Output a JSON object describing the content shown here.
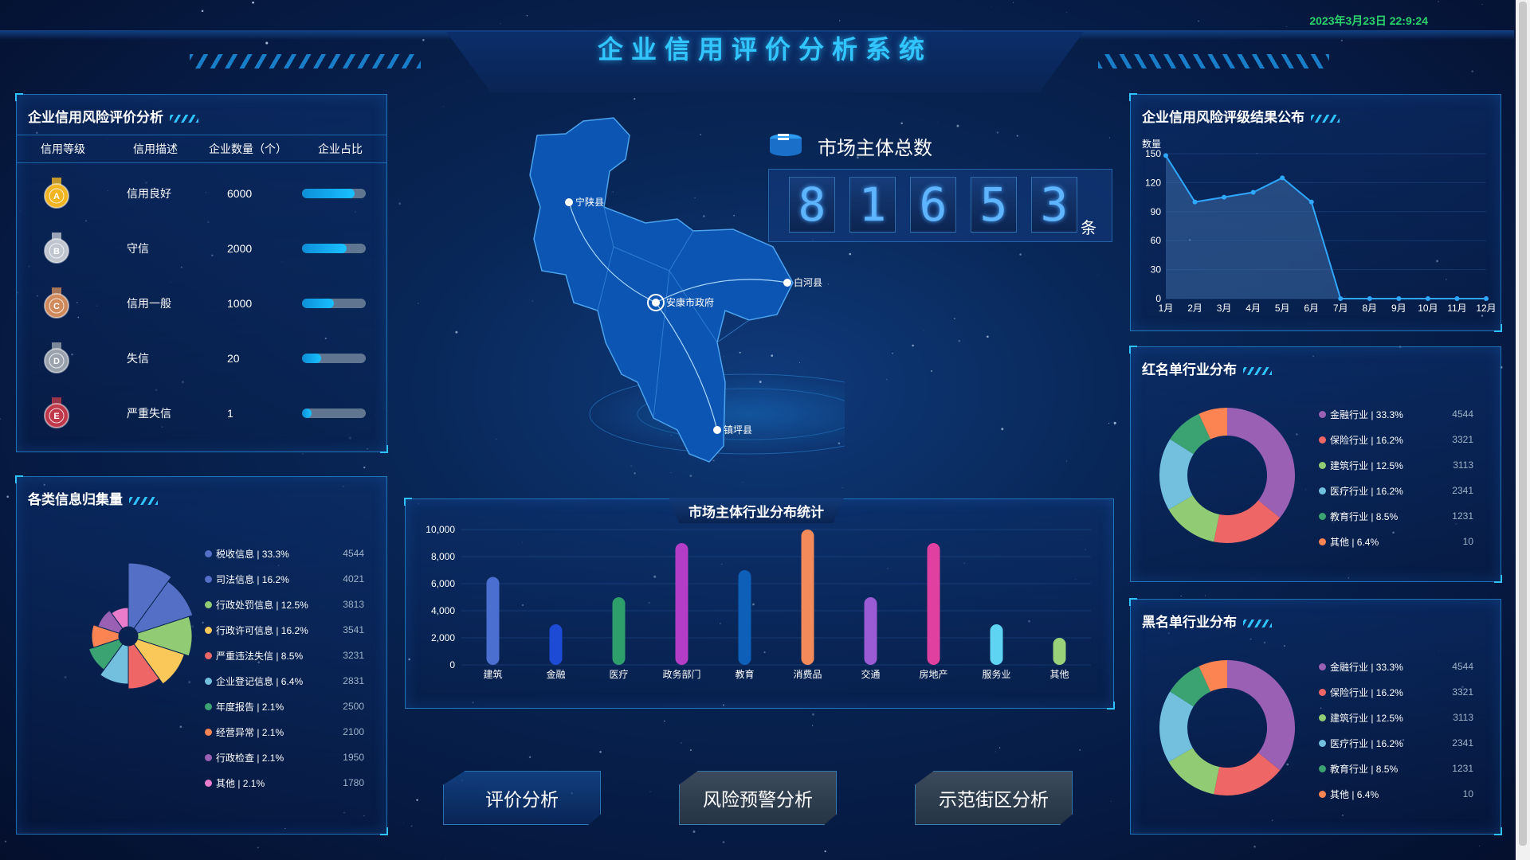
{
  "header": {
    "title": "企业信用评价分析系统",
    "datetime": "2023年3月23日 22:9:24"
  },
  "credit_panel": {
    "title": "企业信用风险评价分析",
    "columns": [
      "信用等级",
      "信用描述",
      "企业数量（个）",
      "企业占比"
    ],
    "rows": [
      {
        "grade": "A",
        "desc": "信用良好",
        "count": "6000",
        "ratio": 0.82,
        "color": "#f1b522"
      },
      {
        "grade": "B",
        "desc": "守信",
        "count": "2000",
        "ratio": 0.7,
        "color": "#bfc6cf"
      },
      {
        "grade": "C",
        "desc": "信用一般",
        "count": "1000",
        "ratio": 0.5,
        "color": "#d0895a"
      },
      {
        "grade": "D",
        "desc": "失信",
        "count": "20",
        "ratio": 0.3,
        "color": "#9aa3ad"
      },
      {
        "grade": "E",
        "desc": "严重失信",
        "count": "1",
        "ratio": 0.15,
        "color": "#c0394a"
      }
    ]
  },
  "info_panel": {
    "title": "各类信息归集量",
    "items": [
      {
        "label": "税收信息 | 33.3%",
        "value": "4544",
        "color": "#5470c6"
      },
      {
        "label": "司法信息 | 16.2%",
        "value": "4021",
        "color": "#5470c6"
      },
      {
        "label": "行政处罚信息 | 12.5%",
        "value": "3813",
        "color": "#91cc75"
      },
      {
        "label": "行政许可信息 | 16.2%",
        "value": "3541",
        "color": "#fac858"
      },
      {
        "label": "严重违法失信 | 8.5%",
        "value": "3231",
        "color": "#ee6666"
      },
      {
        "label": "企业登记信息 | 6.4%",
        "value": "2831",
        "color": "#73c0de"
      },
      {
        "label": "年度报告 | 2.1%",
        "value": "2500",
        "color": "#3ba272"
      },
      {
        "label": "经营异常 | 2.1%",
        "value": "2100",
        "color": "#fc8452"
      },
      {
        "label": "行政检查 | 2.1%",
        "value": "1950",
        "color": "#9a60b4"
      },
      {
        "label": "其他 | 2.1%",
        "value": "1780",
        "color": "#ea7ccc"
      }
    ]
  },
  "map": {
    "counties": [
      "宁陕县",
      "白河县",
      "安康市政府",
      "镇坪县"
    ],
    "total_title": "市场主体总数",
    "total_digits": [
      "8",
      "1",
      "6",
      "5",
      "3"
    ],
    "unit": "条"
  },
  "bar_panel": {
    "title": "市场主体行业分布统计"
  },
  "chart_data": [
    {
      "type": "bar",
      "title": "市场主体行业分布统计",
      "categories": [
        "建筑",
        "金融",
        "医疗",
        "政务部门",
        "教育",
        "消费品",
        "交通",
        "房地产",
        "服务业",
        "其他"
      ],
      "values": [
        6500,
        3000,
        5000,
        9000,
        7000,
        10000,
        5000,
        9000,
        3000,
        2000
      ],
      "ylim": [
        0,
        10000
      ],
      "yticks": [
        "0",
        "2,000",
        "4,000",
        "6,000",
        "8,000",
        "10,000"
      ],
      "colors": [
        "#4a6fd1",
        "#1d4bd6",
        "#2e9e6a",
        "#b33dc6",
        "#0e5fb8",
        "#f28a5a",
        "#9a5bd4",
        "#e040a0",
        "#5fd3f2",
        "#9ad27a"
      ]
    },
    {
      "type": "area",
      "title": "企业信用风险评级结果公布",
      "ylabel": "数量",
      "categories": [
        "1月",
        "2月",
        "3月",
        "4月",
        "5月",
        "6月",
        "7月",
        "8月",
        "9月",
        "10月",
        "11月",
        "12月"
      ],
      "values": [
        148,
        100,
        105,
        110,
        125,
        100,
        0,
        0,
        0,
        0,
        0,
        0
      ],
      "ylim": [
        0,
        150
      ],
      "yticks": [
        "0",
        "30",
        "60",
        "90",
        "120",
        "150"
      ]
    },
    {
      "type": "pie",
      "title": "红名单行业分布",
      "labels": [
        "金融行业 | 33.3%",
        "保险行业 | 16.2%",
        "建筑行业 | 12.5%",
        "医疗行业 | 16.2%",
        "教育行业 | 8.5%",
        "其他 | 6.4%"
      ],
      "values": [
        4544,
        3321,
        3113,
        2341,
        1231,
        10
      ],
      "shares": [
        33.3,
        16.2,
        12.5,
        16.2,
        8.5,
        6.4
      ],
      "colors": [
        "#9a60b4",
        "#ee6666",
        "#91cc75",
        "#73c0de",
        "#3ba272",
        "#fc8452"
      ]
    },
    {
      "type": "pie",
      "title": "黑名单行业分布",
      "labels": [
        "金融行业 | 33.3%",
        "保险行业 | 16.2%",
        "建筑行业 | 12.5%",
        "医疗行业 | 16.2%",
        "教育行业 | 8.5%",
        "其他 | 6.4%"
      ],
      "values": [
        4544,
        3321,
        3113,
        2341,
        1231,
        10
      ],
      "shares": [
        33.3,
        16.2,
        12.5,
        16.2,
        8.5,
        6.4
      ],
      "colors": [
        "#9a60b4",
        "#ee6666",
        "#91cc75",
        "#73c0de",
        "#3ba272",
        "#fc8452"
      ]
    }
  ],
  "buttons": [
    "评价分析",
    "风险预警分析",
    "示范街区分析"
  ]
}
